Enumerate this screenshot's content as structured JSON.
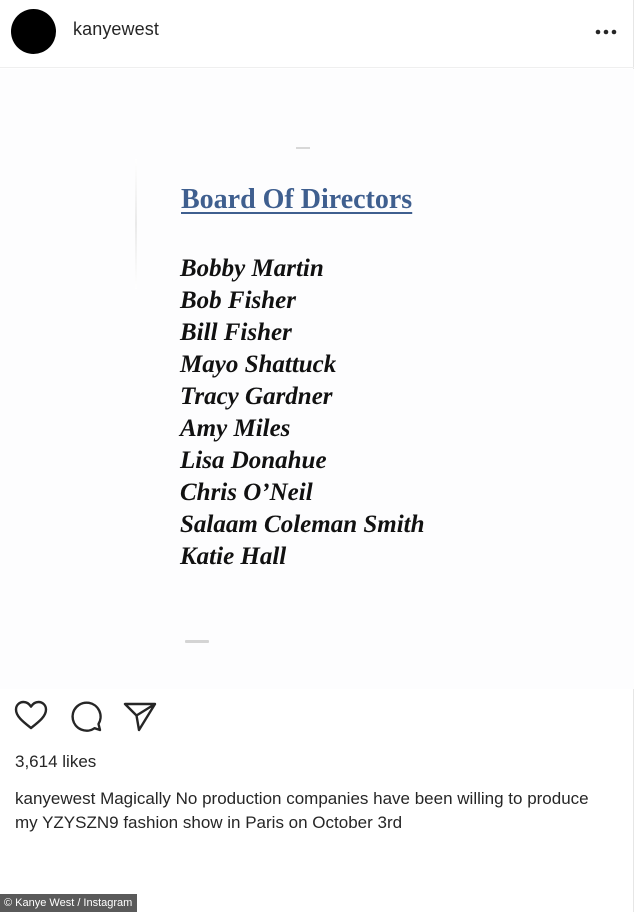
{
  "header": {
    "username": "kanyewest",
    "more_icon": "more-horizontal-icon"
  },
  "document": {
    "title": "Board Of Directors",
    "title_color": "#3f5f8f",
    "directors": [
      "Bobby Martin",
      "Bob Fisher",
      "Bill Fisher",
      "Mayo Shattuck",
      "Tracy Gardner",
      "Amy Miles",
      "Lisa Donahue",
      "Chris O’Neil",
      "Salaam Coleman Smith",
      "Katie Hall"
    ]
  },
  "actions": {
    "icons": [
      "heart-icon",
      "comment-icon",
      "share-icon"
    ]
  },
  "likes": "3,614 likes",
  "caption": {
    "username": "kanyewest",
    "text": "Magically No production companies have been willing to produce my YZYSZN9 fashion show in Paris on October 3rd"
  },
  "credit": "© Kanye West / Instagram"
}
